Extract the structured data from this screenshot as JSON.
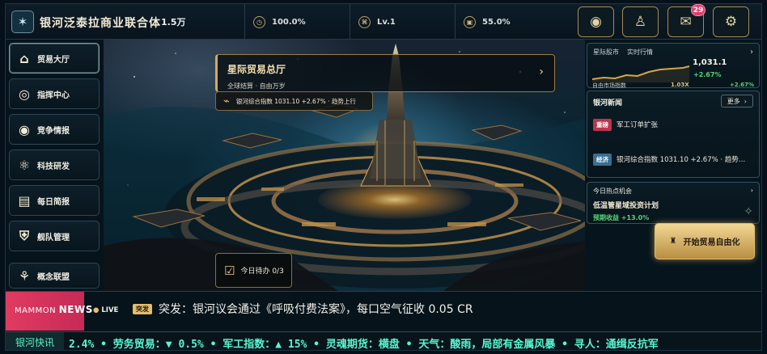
{
  "header": {
    "logo_icon": "galaxy-shield-icon",
    "title": "银河泛泰拉商业联合体",
    "credits": "1.5万",
    "stats": [
      {
        "icon": "gauge-icon",
        "value": "100.0%"
      },
      {
        "icon": "level-badge-icon",
        "value": "Lv.1"
      },
      {
        "icon": "storage-icon",
        "value": "55.0%"
      }
    ],
    "actions": [
      {
        "icon": "planet-icon"
      },
      {
        "icon": "profile-icon"
      },
      {
        "icon": "mail-icon",
        "badge": "29"
      },
      {
        "icon": "gear-icon"
      }
    ]
  },
  "sidebar": {
    "items": [
      {
        "label": "贸易大厅",
        "icon": "bank-icon"
      },
      {
        "label": "指挥中心",
        "icon": "target-icon"
      },
      {
        "label": "竞争情报",
        "icon": "eye-icon"
      },
      {
        "label": "科技研发",
        "icon": "atom-icon"
      },
      {
        "label": "每日简报",
        "icon": "report-icon"
      },
      {
        "label": "舰队管理",
        "icon": "shield-check-icon"
      },
      {
        "label": "概念联盟",
        "icon": "alliance-icon"
      }
    ]
  },
  "main": {
    "hall_title": "星际贸易总厅",
    "hall_subtitle": "全球结算 · 自由万岁",
    "index_chip": "银河综合指数 1031.10 +2.67% · 趋势上行",
    "todo_label": "今日待办 0/3"
  },
  "market": {
    "title": "星际股市",
    "subtitle": "实时行情",
    "value": "1,031.1",
    "change": "+2.67%",
    "footer_label": "自由市场指数",
    "leverage": "1.03X",
    "footer_change": "+2.67%",
    "trend_color": "#d5a64c"
  },
  "news": {
    "title": "银河新闻",
    "more": "更多",
    "items": [
      {
        "tag": "重磅",
        "text": "军工订单扩张",
        "tag_color": "#bd344c"
      },
      {
        "tag": "经济",
        "text": "银河综合指数 1031.10 +2.67% · 趋势…",
        "tag_color": "#3a6f92"
      }
    ]
  },
  "hot": {
    "heading": "今日热点机会",
    "title": "低温管星域投资计划",
    "subtitle": "预期收益 +13.0%"
  },
  "start_button": {
    "label": "开始贸易自由化"
  },
  "breaking_news": {
    "brand_prefix": "MAMMON",
    "brand_suffix": "NEWS",
    "live": "LIVE",
    "tag": "突发",
    "headline": "突发：银河议会通过《呼吸付费法案》，每口空气征收 0.05 CR"
  },
  "ticker": {
    "label": "银河快讯",
    "text": "2.4%  • 劳务贸易：▼ 0.5%  • 军工指数：▲ 15%  • 灵魂期货：横盘  • 天气：酸雨，局部有金属风暴  • 寻人：通缉反抗军"
  }
}
